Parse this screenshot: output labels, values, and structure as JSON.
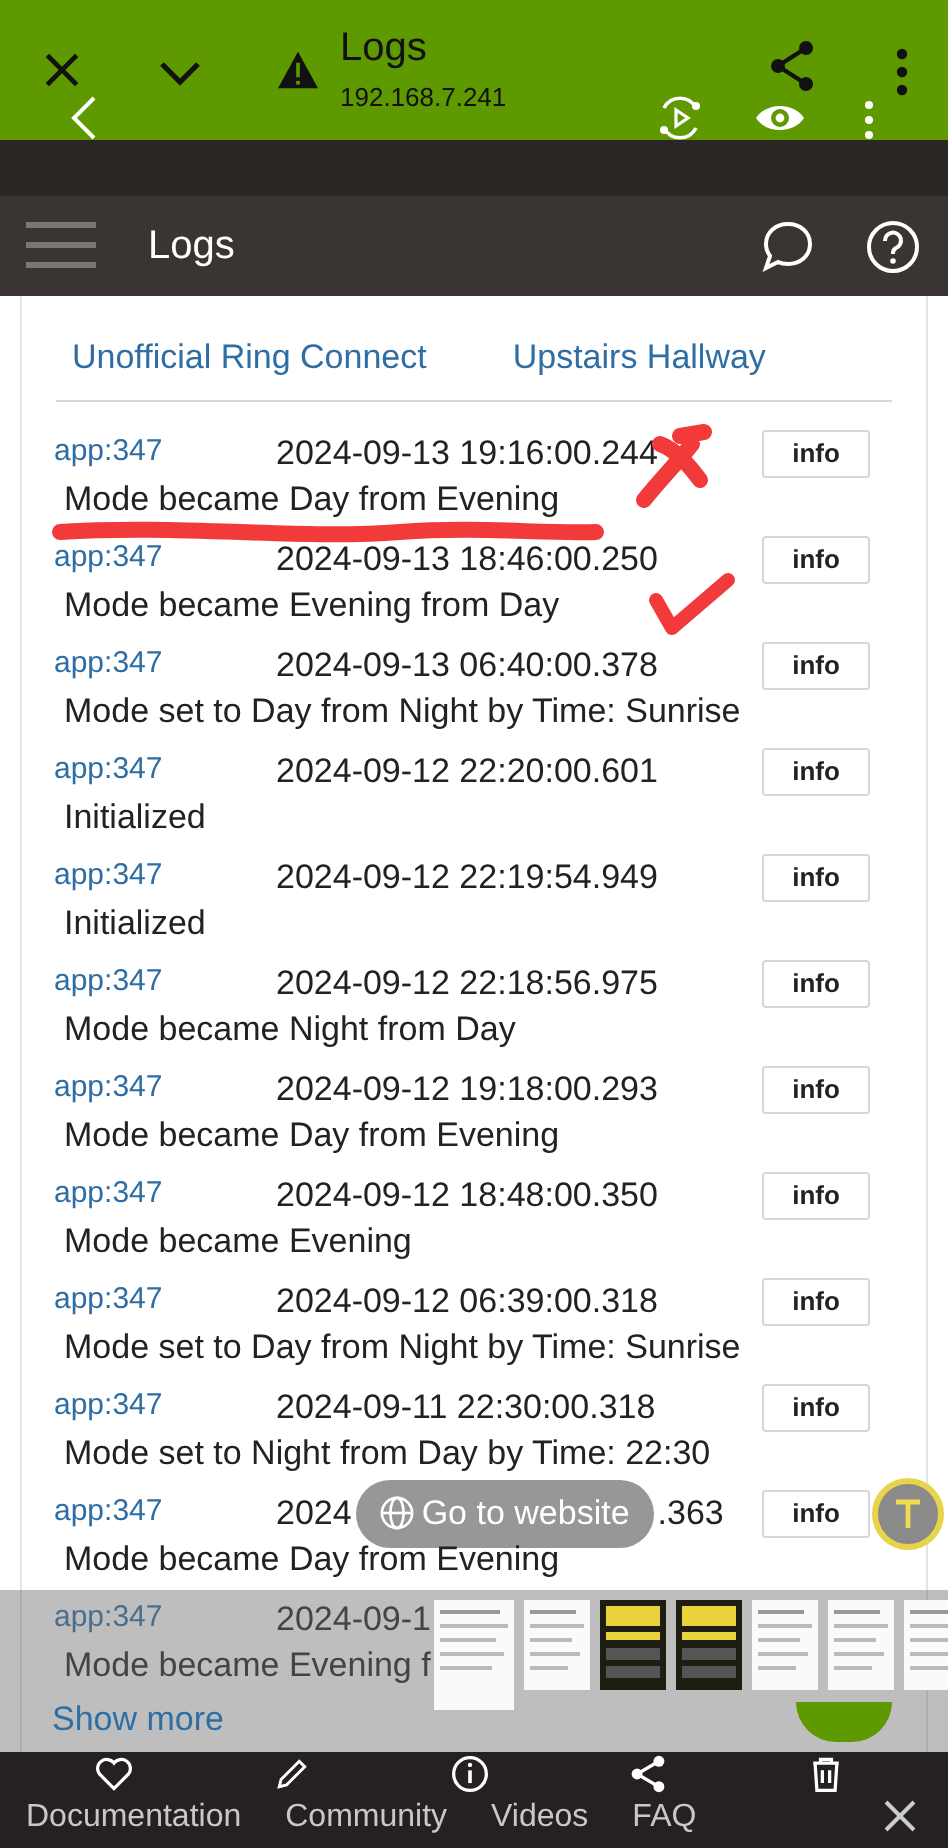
{
  "browser_bar": {
    "title": "Logs",
    "address": "192.168.7.241"
  },
  "app_bar": {
    "title": "Logs"
  },
  "links": [
    "Unofficial Ring Connect",
    "Upstairs Hallway"
  ],
  "log_rows": [
    {
      "source": "app:347",
      "timestamp": "2024-09-13 19:16:00.244",
      "message": "Mode became Day from Evening",
      "button": "info"
    },
    {
      "source": "app:347",
      "timestamp": "2024-09-13 18:46:00.250",
      "message": "Mode became Evening from Day",
      "button": "info"
    },
    {
      "source": "app:347",
      "timestamp": "2024-09-13 06:40:00.378",
      "message": "Mode set to Day from Night by Time: Sunrise",
      "button": "info"
    },
    {
      "source": "app:347",
      "timestamp": "2024-09-12 22:20:00.601",
      "message": "Initialized",
      "button": "info"
    },
    {
      "source": "app:347",
      "timestamp": "2024-09-12 22:19:54.949",
      "message": "Initialized",
      "button": "info"
    },
    {
      "source": "app:347",
      "timestamp": "2024-09-12 22:18:56.975",
      "message": "Mode became Night from Day",
      "button": "info"
    },
    {
      "source": "app:347",
      "timestamp": "2024-09-12 19:18:00.293",
      "message": "Mode became Day from Evening",
      "button": "info"
    },
    {
      "source": "app:347",
      "timestamp": "2024-09-12 18:48:00.350",
      "message": "Mode became Evening",
      "button": "info"
    },
    {
      "source": "app:347",
      "timestamp": "2024-09-12 06:39:00.318",
      "message": "Mode set to Day from Night by Time: Sunrise",
      "button": "info"
    },
    {
      "source": "app:347",
      "timestamp": "2024-09-11 22:30:00.318",
      "message": "Mode set to Night from Day by Time: 22:30",
      "button": "info"
    },
    {
      "source": "app:347",
      "timestamp": "2024",
      "timestamp_tail": ".363",
      "message": "Mode became Day from Evening",
      "button": "info"
    },
    {
      "source": "app:347",
      "timestamp": "2024-09-1",
      "message": "Mode became Evening f"
    }
  ],
  "annotations": [
    {
      "kind": "underline"
    },
    {
      "kind": "cross"
    },
    {
      "kind": "check"
    }
  ],
  "website_pill": {
    "label": "Go to website"
  },
  "thumbnails": [
    {
      "kind": "document"
    },
    {
      "kind": "document"
    },
    {
      "kind": "poster"
    },
    {
      "kind": "poster"
    },
    {
      "kind": "document"
    },
    {
      "kind": "document"
    },
    {
      "kind": "document"
    }
  ],
  "show_more": "Show more",
  "bottom_bar": {
    "labels": [
      "Documentation",
      "Community",
      "Videos",
      "FAQ"
    ]
  }
}
